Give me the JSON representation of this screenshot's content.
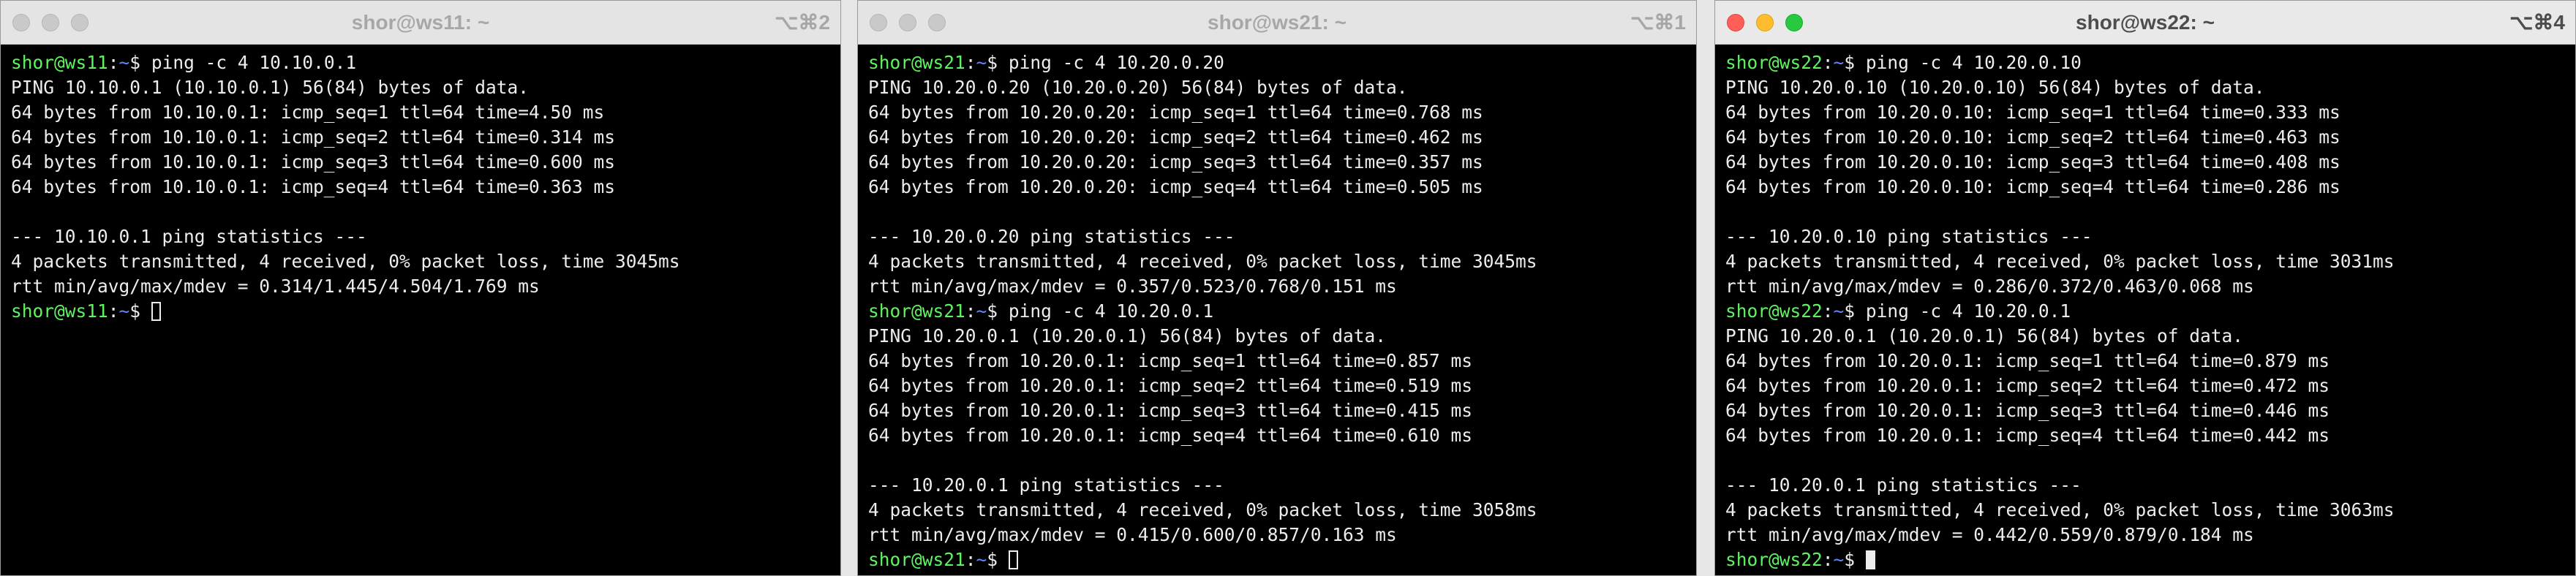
{
  "windows": [
    {
      "title": "shor@ws11: ~",
      "shortcut": "⌥⌘2",
      "active": false,
      "prompt": {
        "user_host": "shor@ws11",
        "path": "~",
        "symbol": "$"
      },
      "lines": [
        {
          "kind": "cmd",
          "text": " ping -c 4 10.10.0.1"
        },
        {
          "kind": "out",
          "text": "PING 10.10.0.1 (10.10.0.1) 56(84) bytes of data."
        },
        {
          "kind": "out",
          "text": "64 bytes from 10.10.0.1: icmp_seq=1 ttl=64 time=4.50 ms"
        },
        {
          "kind": "out",
          "text": "64 bytes from 10.10.0.1: icmp_seq=2 ttl=64 time=0.314 ms"
        },
        {
          "kind": "out",
          "text": "64 bytes from 10.10.0.1: icmp_seq=3 ttl=64 time=0.600 ms"
        },
        {
          "kind": "out",
          "text": "64 bytes from 10.10.0.1: icmp_seq=4 ttl=64 time=0.363 ms"
        },
        {
          "kind": "out",
          "text": ""
        },
        {
          "kind": "out",
          "text": "--- 10.10.0.1 ping statistics ---"
        },
        {
          "kind": "out",
          "text": "4 packets transmitted, 4 received, 0% packet loss, time 3045ms"
        },
        {
          "kind": "out",
          "text": "rtt min/avg/max/mdev = 0.314/1.445/4.504/1.769 ms"
        },
        {
          "kind": "cursor",
          "text": " "
        }
      ]
    },
    {
      "title": "shor@ws21: ~",
      "shortcut": "⌥⌘1",
      "active": false,
      "prompt": {
        "user_host": "shor@ws21",
        "path": "~",
        "symbol": "$"
      },
      "lines": [
        {
          "kind": "cmd",
          "text": " ping -c 4 10.20.0.20"
        },
        {
          "kind": "out",
          "text": "PING 10.20.0.20 (10.20.0.20) 56(84) bytes of data."
        },
        {
          "kind": "out",
          "text": "64 bytes from 10.20.0.20: icmp_seq=1 ttl=64 time=0.768 ms"
        },
        {
          "kind": "out",
          "text": "64 bytes from 10.20.0.20: icmp_seq=2 ttl=64 time=0.462 ms"
        },
        {
          "kind": "out",
          "text": "64 bytes from 10.20.0.20: icmp_seq=3 ttl=64 time=0.357 ms"
        },
        {
          "kind": "out",
          "text": "64 bytes from 10.20.0.20: icmp_seq=4 ttl=64 time=0.505 ms"
        },
        {
          "kind": "out",
          "text": ""
        },
        {
          "kind": "out",
          "text": "--- 10.20.0.20 ping statistics ---"
        },
        {
          "kind": "out",
          "text": "4 packets transmitted, 4 received, 0% packet loss, time 3045ms"
        },
        {
          "kind": "out",
          "text": "rtt min/avg/max/mdev = 0.357/0.523/0.768/0.151 ms"
        },
        {
          "kind": "cmd",
          "text": " ping -c 4 10.20.0.1"
        },
        {
          "kind": "out",
          "text": "PING 10.20.0.1 (10.20.0.1) 56(84) bytes of data."
        },
        {
          "kind": "out",
          "text": "64 bytes from 10.20.0.1: icmp_seq=1 ttl=64 time=0.857 ms"
        },
        {
          "kind": "out",
          "text": "64 bytes from 10.20.0.1: icmp_seq=2 ttl=64 time=0.519 ms"
        },
        {
          "kind": "out",
          "text": "64 bytes from 10.20.0.1: icmp_seq=3 ttl=64 time=0.415 ms"
        },
        {
          "kind": "out",
          "text": "64 bytes from 10.20.0.1: icmp_seq=4 ttl=64 time=0.610 ms"
        },
        {
          "kind": "out",
          "text": ""
        },
        {
          "kind": "out",
          "text": "--- 10.20.0.1 ping statistics ---"
        },
        {
          "kind": "out",
          "text": "4 packets transmitted, 4 received, 0% packet loss, time 3058ms"
        },
        {
          "kind": "out",
          "text": "rtt min/avg/max/mdev = 0.415/0.600/0.857/0.163 ms"
        },
        {
          "kind": "cursor",
          "text": " "
        }
      ]
    },
    {
      "title": "shor@ws22: ~",
      "shortcut": "⌥⌘4",
      "active": true,
      "prompt": {
        "user_host": "shor@ws22",
        "path": "~",
        "symbol": "$"
      },
      "lines": [
        {
          "kind": "cmd",
          "text": " ping -c 4 10.20.0.10"
        },
        {
          "kind": "out",
          "text": "PING 10.20.0.10 (10.20.0.10) 56(84) bytes of data."
        },
        {
          "kind": "out",
          "text": "64 bytes from 10.20.0.10: icmp_seq=1 ttl=64 time=0.333 ms"
        },
        {
          "kind": "out",
          "text": "64 bytes from 10.20.0.10: icmp_seq=2 ttl=64 time=0.463 ms"
        },
        {
          "kind": "out",
          "text": "64 bytes from 10.20.0.10: icmp_seq=3 ttl=64 time=0.408 ms"
        },
        {
          "kind": "out",
          "text": "64 bytes from 10.20.0.10: icmp_seq=4 ttl=64 time=0.286 ms"
        },
        {
          "kind": "out",
          "text": ""
        },
        {
          "kind": "out",
          "text": "--- 10.20.0.10 ping statistics ---"
        },
        {
          "kind": "out",
          "text": "4 packets transmitted, 4 received, 0% packet loss, time 3031ms"
        },
        {
          "kind": "out",
          "text": "rtt min/avg/max/mdev = 0.286/0.372/0.463/0.068 ms"
        },
        {
          "kind": "cmd",
          "text": " ping -c 4 10.20.0.1"
        },
        {
          "kind": "out",
          "text": "PING 10.20.0.1 (10.20.0.1) 56(84) bytes of data."
        },
        {
          "kind": "out",
          "text": "64 bytes from 10.20.0.1: icmp_seq=1 ttl=64 time=0.879 ms"
        },
        {
          "kind": "out",
          "text": "64 bytes from 10.20.0.1: icmp_seq=2 ttl=64 time=0.472 ms"
        },
        {
          "kind": "out",
          "text": "64 bytes from 10.20.0.1: icmp_seq=3 ttl=64 time=0.446 ms"
        },
        {
          "kind": "out",
          "text": "64 bytes from 10.20.0.1: icmp_seq=4 ttl=64 time=0.442 ms"
        },
        {
          "kind": "out",
          "text": ""
        },
        {
          "kind": "out",
          "text": "--- 10.20.0.1 ping statistics ---"
        },
        {
          "kind": "out",
          "text": "4 packets transmitted, 4 received, 0% packet loss, time 3063ms"
        },
        {
          "kind": "out",
          "text": "rtt min/avg/max/mdev = 0.442/0.559/0.879/0.184 ms"
        },
        {
          "kind": "cursor",
          "text": " "
        }
      ]
    }
  ],
  "colors": {
    "terminal_bg": "#000000",
    "terminal_text": "#ededed",
    "prompt_user": "#5ff35f",
    "prompt_path": "#5f87ff",
    "close_light": "#ff5f57",
    "minimize_light": "#febc2e",
    "zoom_light": "#28c840"
  }
}
